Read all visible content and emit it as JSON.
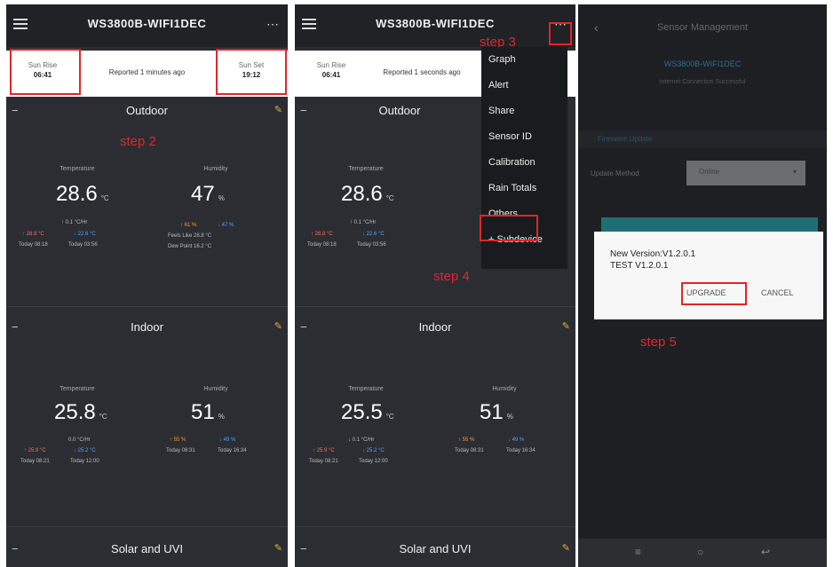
{
  "panel1": {
    "title": "WS3800B-WIFI1DEC",
    "sunrise_label": "Sun Rise",
    "sunrise_value": "06:41",
    "reported": "Reported 1 minutes ago",
    "sunset_label": "Sun Set",
    "sunset_value": "19:12",
    "step": "step 2",
    "outdoor": {
      "section": "Outdoor",
      "temp_label": "Temperature",
      "temp_value": "28.6",
      "temp_unit": "°C",
      "temp_rate": "↑ 0.1 °C/Hr",
      "temp_high": "↑ 28.8 °C",
      "temp_low": "↓ 22.6 °C",
      "temp_high_time": "Today 08:18",
      "temp_low_time": "Today 03:56",
      "hum_label": "Humidity",
      "hum_value": "47",
      "hum_unit": "%",
      "hum_high": "↑ 61 %",
      "hum_low": "↓ 47 %",
      "feels_like": "Feels Like  28.8 °C",
      "dew_point": "Dew Point  16.2 °C"
    },
    "indoor": {
      "section": "Indoor",
      "temp_label": "Temperature",
      "temp_value": "25.8",
      "temp_unit": "°C",
      "temp_rate": "0.0 °C/Hr",
      "temp_high": "↑ 25.9 °C",
      "temp_low": "↓ 25.2 °C",
      "temp_high_time": "Today 08:21",
      "temp_low_time": "Today 12:00",
      "hum_label": "Humidity",
      "hum_value": "51",
      "hum_unit": "%",
      "hum_high": "↑ 55 %",
      "hum_low": "↓ 49 %",
      "hum_high_time": "Today 08:31",
      "hum_low_time": "Today 16:34"
    },
    "solar": "Solar and UVI"
  },
  "panel2": {
    "title": "WS3800B-WIFI1DEC",
    "sunrise_label": "Sun Rise",
    "sunrise_value": "06:41",
    "reported": "Reported 1 seconds ago",
    "step3": "step 3",
    "step4": "step 4",
    "menu": [
      "Graph",
      "Alert",
      "Share",
      "Sensor ID",
      "Calibration",
      "Rain Totals",
      "Others",
      "+ Subdevice"
    ],
    "outdoor": {
      "section": "Outdoor",
      "temp_label": "Temperature",
      "temp_value": "28.6",
      "temp_unit": "°C",
      "temp_rate": "↑ 0.1 °C/Hr",
      "temp_high": "↑ 28.8 °C",
      "temp_low": "↓ 22.6 °C",
      "temp_high_time": "Today 08:18",
      "temp_low_time": "Today 03:56"
    },
    "indoor": {
      "section": "Indoor",
      "temp_label": "Temperature",
      "temp_value": "25.5",
      "temp_unit": "°C",
      "temp_rate": "↓ 0.1 °C/Hr",
      "temp_high": "↑ 25.9 °C",
      "temp_low": "↓ 25.2 °C",
      "temp_high_time": "Today 08:21",
      "temp_low_time": "Today 12:00",
      "hum_label": "Humidity",
      "hum_value": "51",
      "hum_unit": "%",
      "hum_high": "↑ 55 %",
      "hum_low": "↓ 49 %",
      "hum_high_time": "Today 08:31",
      "hum_low_time": "Today 16:34"
    },
    "solar": "Solar and UVI"
  },
  "panel3": {
    "title": "Sensor Management",
    "device": "WS3800B-WIFI1DEC",
    "status": "Internet Connection Successful",
    "section": "Firmware Update",
    "update_label": "Update Method",
    "update_value": "Online",
    "dialog_line1": "New Version:V1.2.0.1",
    "dialog_line2": "TEST  V1.2.0.1",
    "upgrade": "UPGRADE",
    "cancel": "CANCEL",
    "step": "step 5"
  },
  "colors": {
    "accent_red": "#e0262c",
    "panel_bg": "#2b2d33",
    "pin": "#e0b23a"
  }
}
